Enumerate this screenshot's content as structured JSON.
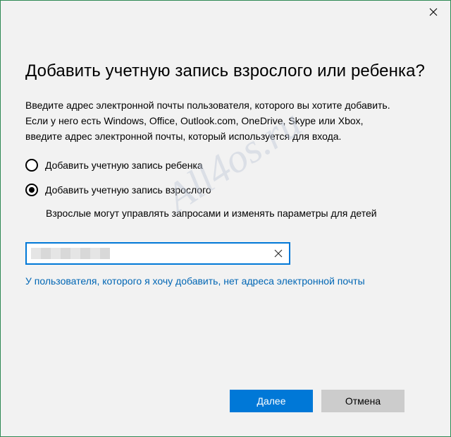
{
  "dialog": {
    "title": "Добавить учетную запись взрослого или ребенка?",
    "description": [
      "Введите адрес электронной почты пользователя, которого вы хотите добавить.",
      "Если у него есть Windows, Office, Outlook.com, OneDrive, Skype или Xbox,",
      "введите адрес электронной почты, который используется для входа."
    ],
    "options": [
      {
        "label": "Добавить учетную запись ребенка",
        "checked": false
      },
      {
        "label": "Добавить учетную запись взрослого",
        "checked": true
      }
    ],
    "hint": "Взрослые могут управлять запросами и изменять параметры для детей",
    "email": {
      "value": "",
      "placeholder": ""
    },
    "no_email_link": "У пользователя, которого я хочу добавить, нет адреса электронной почты",
    "buttons": {
      "next": "Далее",
      "cancel": "Отмена"
    }
  },
  "watermark": "All4os.ru",
  "icons": {
    "close": "close-icon",
    "clear": "clear-icon"
  },
  "colors": {
    "accent": "#0078d7",
    "link": "#0066b4",
    "window_border": "#2f8a54"
  }
}
